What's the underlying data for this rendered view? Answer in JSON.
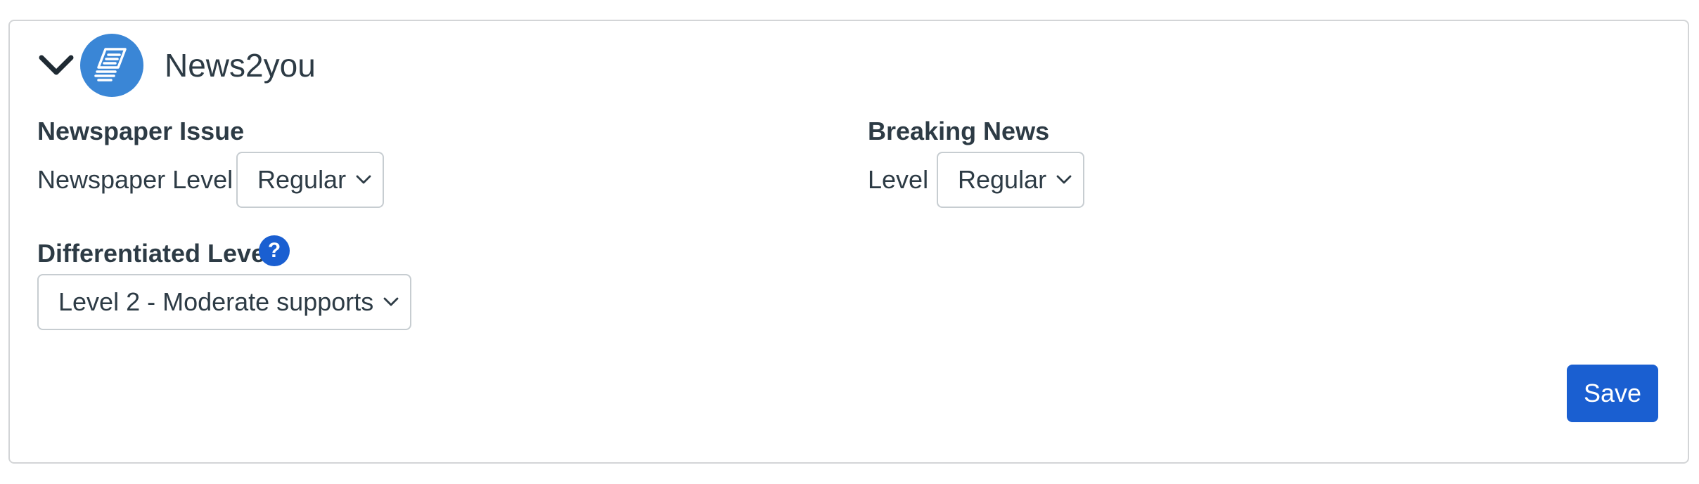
{
  "header": {
    "toggle_icon": "chevron-down-icon",
    "logo_icon": "newspaper-stack-icon",
    "logo_color": "#3a86d6",
    "title": "News2you"
  },
  "newspaper_issue": {
    "heading": "Newspaper Issue",
    "level_label": "Newspaper Level",
    "level_value": "Regular"
  },
  "breaking_news": {
    "heading": "Breaking News",
    "level_label": "Level",
    "level_value": "Regular"
  },
  "differentiated_level": {
    "heading": "Differentiated Level",
    "help_icon": "question-circle-icon",
    "help_glyph": "?",
    "value": "Level 2 - Moderate supports"
  },
  "actions": {
    "save_label": "Save",
    "accent_color": "#1a5fd1"
  }
}
